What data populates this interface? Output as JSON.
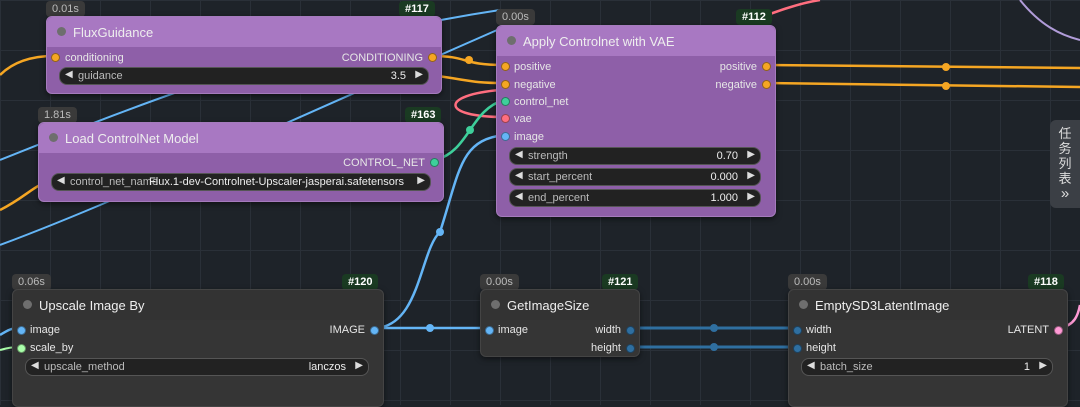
{
  "colors": {
    "conditioning": "#f5a623",
    "image": "#64b5f6",
    "control_net": "#3ecf9b",
    "vae": "#ff6e7f",
    "latent": "#ff9ad5",
    "float": "#aaffaa",
    "int": "#2f6fa0"
  },
  "sidebar_tab": {
    "label": "任务列表",
    "chevron": "»"
  },
  "nodes": {
    "flux_guidance": {
      "time": "0.01s",
      "id": "#117",
      "title": "FluxGuidance",
      "input": "conditioning",
      "output": "CONDITIONING",
      "widgets": [
        {
          "label": "guidance",
          "value": "3.5"
        }
      ]
    },
    "apply_controlnet": {
      "time": "0.00s",
      "id": "#112",
      "title": "Apply Controlnet with VAE",
      "inputs": [
        "positive",
        "negative",
        "control_net",
        "vae",
        "image"
      ],
      "outputs": [
        "positive",
        "negative"
      ],
      "widgets": [
        {
          "label": "strength",
          "value": "0.70"
        },
        {
          "label": "start_percent",
          "value": "0.000"
        },
        {
          "label": "end_percent",
          "value": "1.000"
        }
      ]
    },
    "load_controlnet": {
      "time": "1.81s",
      "id": "#163",
      "title": "Load ControlNet Model",
      "output": "CONTROL_NET",
      "widgets": [
        {
          "label": "control_net_name",
          "value": "Flux.1-dev-Controlnet-Upscaler-jasperai.safetensors"
        }
      ]
    },
    "upscale_image": {
      "time": "0.06s",
      "id": "#120",
      "title": "Upscale Image By",
      "inputs": [
        "image",
        "scale_by"
      ],
      "output": "IMAGE",
      "widgets": [
        {
          "label": "upscale_method",
          "value": "lanczos"
        }
      ]
    },
    "get_image_size": {
      "time": "0.00s",
      "id": "#121",
      "title": "GetImageSize",
      "input": "image",
      "outputs": [
        "width",
        "height"
      ]
    },
    "empty_latent": {
      "time": "0.00s",
      "id": "#118",
      "title": "EmptySD3LatentImage",
      "inputs": [
        "width",
        "height"
      ],
      "output": "LATENT",
      "widgets": [
        {
          "label": "batch_size",
          "value": "1"
        }
      ]
    }
  }
}
